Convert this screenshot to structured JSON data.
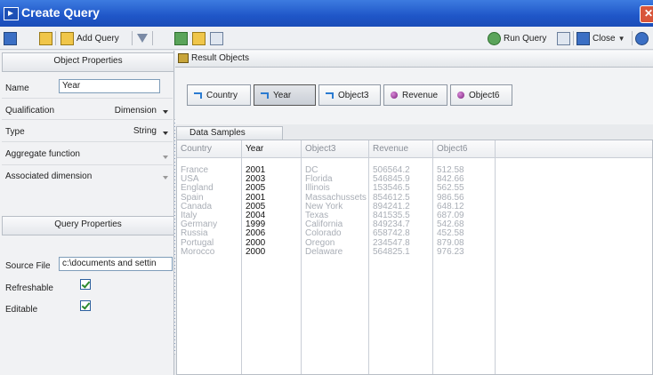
{
  "window": {
    "title": "Create Query"
  },
  "toolbar": {
    "add_query": "Add Query",
    "run_query": "Run Query",
    "close": "Close"
  },
  "object_properties": {
    "header": "Object Properties",
    "name_label": "Name",
    "name_value": "Year",
    "qualification_label": "Qualification",
    "qualification_value": "Dimension",
    "type_label": "Type",
    "type_value": "String",
    "aggregate_label": "Aggregate function",
    "associated_label": "Associated dimension"
  },
  "query_properties": {
    "header": "Query Properties",
    "source_label": "Source File",
    "source_value": "c:\\documents and settin",
    "refreshable_label": "Refreshable",
    "refreshable_checked": true,
    "editable_label": "Editable",
    "editable_checked": true
  },
  "result_objects": {
    "header": "Result Objects",
    "items": [
      {
        "label": "Country",
        "kind": "dimension",
        "selected": false
      },
      {
        "label": "Year",
        "kind": "dimension",
        "selected": true
      },
      {
        "label": "Object3",
        "kind": "dimension",
        "selected": false
      },
      {
        "label": "Revenue",
        "kind": "measure",
        "selected": false
      },
      {
        "label": "Object6",
        "kind": "measure",
        "selected": false
      }
    ]
  },
  "data_samples": {
    "tab": "Data Samples",
    "columns": [
      {
        "header": "Country",
        "active": false,
        "values": [
          "France",
          "USA",
          "England",
          "Spain",
          "Canada",
          "Italy",
          "Germany",
          "Russia",
          "Portugal",
          "Morocco"
        ]
      },
      {
        "header": "Year",
        "active": true,
        "values": [
          "2001",
          "2003",
          "2005",
          "2001",
          "2005",
          "2004",
          "1999",
          "2006",
          "2000",
          "2000"
        ]
      },
      {
        "header": "Object3",
        "active": false,
        "values": [
          "DC",
          "Florida",
          "Illinois",
          "Massachussets",
          "New York",
          "Texas",
          "California",
          "Colorado",
          "Oregon",
          "Delaware"
        ]
      },
      {
        "header": "Revenue",
        "active": false,
        "values": [
          "506564.2",
          "546845.9",
          "153546.5",
          "854612.5",
          "894241.2",
          "841535.5",
          "849234.7",
          "658742.8",
          "234547.8",
          "564825.1"
        ]
      },
      {
        "header": "Object6",
        "active": false,
        "values": [
          "512.58",
          "842.66",
          "562.55",
          "986.56",
          "648.12",
          "687.09",
          "542.68",
          "452.58",
          "879.08",
          "976.23"
        ]
      }
    ]
  }
}
